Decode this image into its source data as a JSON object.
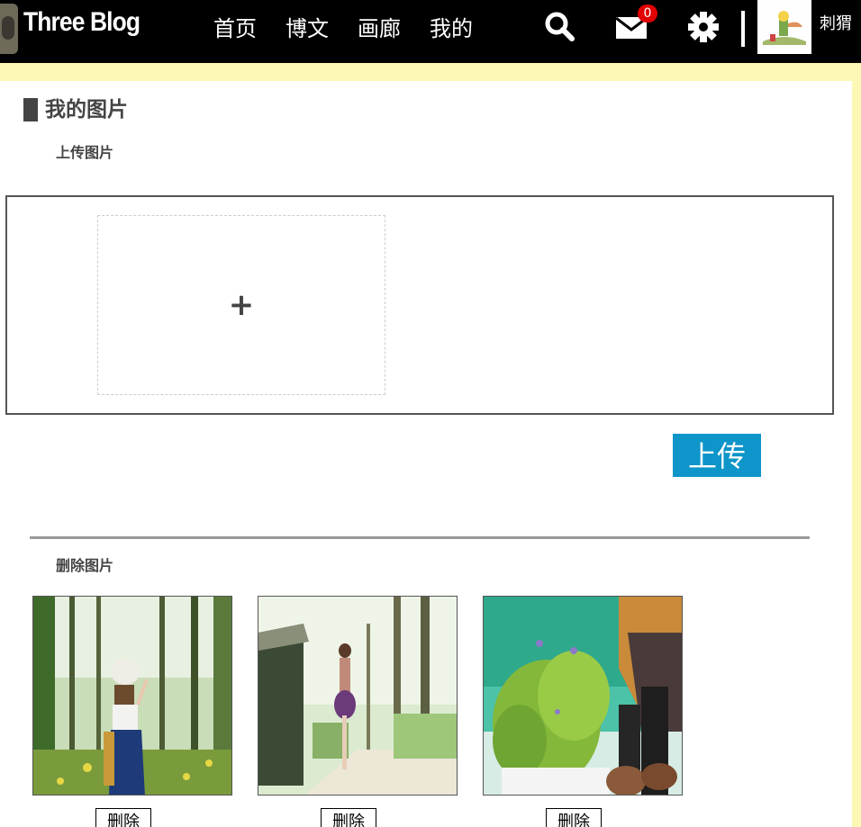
{
  "header": {
    "brand": "Three Blog",
    "nav": [
      "首页",
      "博文",
      "画廊",
      "我的"
    ],
    "mail_count": "0",
    "username": "刺猬"
  },
  "page": {
    "title": "我的图片",
    "upload_label": "上传图片",
    "upload_plus": "+",
    "upload_button": "上传",
    "delete_label": "删除图片",
    "photos": [
      {
        "delete_button": "删除"
      },
      {
        "delete_button": "删除"
      },
      {
        "delete_button": "删除"
      }
    ]
  },
  "colors": {
    "topbar": "#000000",
    "page_background": "#fdf9b4",
    "upload_button": "#0e95c9",
    "badge": "#e10000"
  },
  "icons": [
    "search-icon",
    "mail-icon",
    "gear-icon"
  ]
}
